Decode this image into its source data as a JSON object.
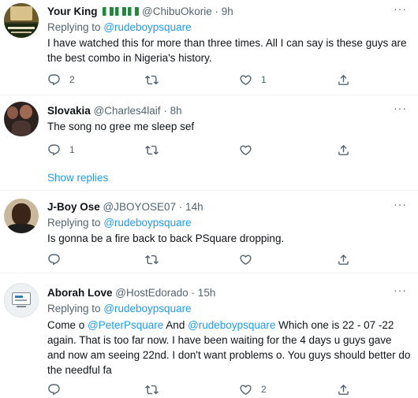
{
  "tweets": [
    {
      "name": "Your King",
      "name_flags": "🇳🇬🇳🇬🇳🇬",
      "handle": "@ChibuOkorie",
      "time": "· 9h",
      "replying_prefix": "Replying to",
      "replying_to": "@rudeboypsquare",
      "text": "I have watched this for more than three times. All I can say is these guys are the best combo in Nigeria's history.",
      "replies": "2",
      "retweets": "",
      "likes": "1"
    },
    {
      "name": "Slovakia",
      "handle": "@Charles4laif",
      "time": "· 8h",
      "text": "The song no gree me sleep sef",
      "replies": "1",
      "retweets": "",
      "likes": ""
    },
    {
      "name": "J-Boy Ose",
      "handle": "@JBOYOSE07",
      "time": "· 14h",
      "replying_prefix": "Replying to",
      "replying_to": "@rudeboypsquare",
      "text": "Is gonna be a fire back to back PSquare dropping.",
      "replies": "",
      "retweets": "",
      "likes": ""
    },
    {
      "name": "Aborah Love",
      "handle": "@HostEdorado",
      "time": "· 15h",
      "replying_prefix": "Replying to",
      "replying_to": "@rudeboypsquare",
      "text_parts": {
        "t1": "Come o ",
        "m1": "@PeterPsquare",
        "t2": " And ",
        "m2": "@rudeboypsquare",
        "t3": " Which one is 22 - 07 -22 again. That is too far now. I have been waiting for the 4 days u guys gave and now am seeing 22nd.  I don't want problems o. You guys should better do the needful fa"
      },
      "replies": "",
      "retweets": "",
      "likes": "2"
    }
  ],
  "show_replies": "Show replies",
  "colors": {
    "link": "#1d9bf0",
    "secondary": "#536471",
    "divider": "#eff3f4"
  },
  "icons": [
    "reply-icon",
    "retweet-icon",
    "like-icon",
    "share-icon",
    "more-icon"
  ]
}
